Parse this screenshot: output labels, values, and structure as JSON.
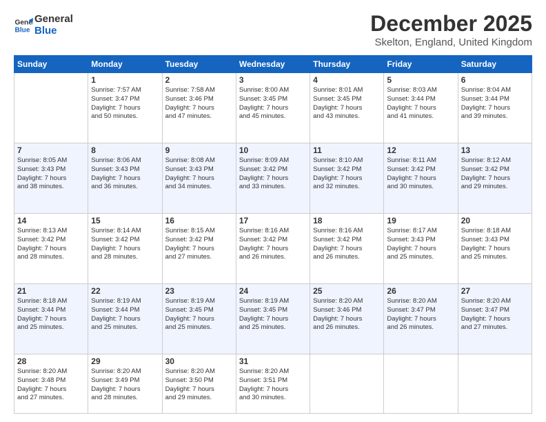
{
  "logo": {
    "line1": "General",
    "line2": "Blue"
  },
  "title": "December 2025",
  "subtitle": "Skelton, England, United Kingdom",
  "days_header": [
    "Sunday",
    "Monday",
    "Tuesday",
    "Wednesday",
    "Thursday",
    "Friday",
    "Saturday"
  ],
  "weeks": [
    [
      {
        "day": "",
        "info": ""
      },
      {
        "day": "1",
        "info": "Sunrise: 7:57 AM\nSunset: 3:47 PM\nDaylight: 7 hours\nand 50 minutes."
      },
      {
        "day": "2",
        "info": "Sunrise: 7:58 AM\nSunset: 3:46 PM\nDaylight: 7 hours\nand 47 minutes."
      },
      {
        "day": "3",
        "info": "Sunrise: 8:00 AM\nSunset: 3:45 PM\nDaylight: 7 hours\nand 45 minutes."
      },
      {
        "day": "4",
        "info": "Sunrise: 8:01 AM\nSunset: 3:45 PM\nDaylight: 7 hours\nand 43 minutes."
      },
      {
        "day": "5",
        "info": "Sunrise: 8:03 AM\nSunset: 3:44 PM\nDaylight: 7 hours\nand 41 minutes."
      },
      {
        "day": "6",
        "info": "Sunrise: 8:04 AM\nSunset: 3:44 PM\nDaylight: 7 hours\nand 39 minutes."
      }
    ],
    [
      {
        "day": "7",
        "info": "Sunrise: 8:05 AM\nSunset: 3:43 PM\nDaylight: 7 hours\nand 38 minutes."
      },
      {
        "day": "8",
        "info": "Sunrise: 8:06 AM\nSunset: 3:43 PM\nDaylight: 7 hours\nand 36 minutes."
      },
      {
        "day": "9",
        "info": "Sunrise: 8:08 AM\nSunset: 3:43 PM\nDaylight: 7 hours\nand 34 minutes."
      },
      {
        "day": "10",
        "info": "Sunrise: 8:09 AM\nSunset: 3:42 PM\nDaylight: 7 hours\nand 33 minutes."
      },
      {
        "day": "11",
        "info": "Sunrise: 8:10 AM\nSunset: 3:42 PM\nDaylight: 7 hours\nand 32 minutes."
      },
      {
        "day": "12",
        "info": "Sunrise: 8:11 AM\nSunset: 3:42 PM\nDaylight: 7 hours\nand 30 minutes."
      },
      {
        "day": "13",
        "info": "Sunrise: 8:12 AM\nSunset: 3:42 PM\nDaylight: 7 hours\nand 29 minutes."
      }
    ],
    [
      {
        "day": "14",
        "info": "Sunrise: 8:13 AM\nSunset: 3:42 PM\nDaylight: 7 hours\nand 28 minutes."
      },
      {
        "day": "15",
        "info": "Sunrise: 8:14 AM\nSunset: 3:42 PM\nDaylight: 7 hours\nand 28 minutes."
      },
      {
        "day": "16",
        "info": "Sunrise: 8:15 AM\nSunset: 3:42 PM\nDaylight: 7 hours\nand 27 minutes."
      },
      {
        "day": "17",
        "info": "Sunrise: 8:16 AM\nSunset: 3:42 PM\nDaylight: 7 hours\nand 26 minutes."
      },
      {
        "day": "18",
        "info": "Sunrise: 8:16 AM\nSunset: 3:42 PM\nDaylight: 7 hours\nand 26 minutes."
      },
      {
        "day": "19",
        "info": "Sunrise: 8:17 AM\nSunset: 3:43 PM\nDaylight: 7 hours\nand 25 minutes."
      },
      {
        "day": "20",
        "info": "Sunrise: 8:18 AM\nSunset: 3:43 PM\nDaylight: 7 hours\nand 25 minutes."
      }
    ],
    [
      {
        "day": "21",
        "info": "Sunrise: 8:18 AM\nSunset: 3:44 PM\nDaylight: 7 hours\nand 25 minutes."
      },
      {
        "day": "22",
        "info": "Sunrise: 8:19 AM\nSunset: 3:44 PM\nDaylight: 7 hours\nand 25 minutes."
      },
      {
        "day": "23",
        "info": "Sunrise: 8:19 AM\nSunset: 3:45 PM\nDaylight: 7 hours\nand 25 minutes."
      },
      {
        "day": "24",
        "info": "Sunrise: 8:19 AM\nSunset: 3:45 PM\nDaylight: 7 hours\nand 25 minutes."
      },
      {
        "day": "25",
        "info": "Sunrise: 8:20 AM\nSunset: 3:46 PM\nDaylight: 7 hours\nand 26 minutes."
      },
      {
        "day": "26",
        "info": "Sunrise: 8:20 AM\nSunset: 3:47 PM\nDaylight: 7 hours\nand 26 minutes."
      },
      {
        "day": "27",
        "info": "Sunrise: 8:20 AM\nSunset: 3:47 PM\nDaylight: 7 hours\nand 27 minutes."
      }
    ],
    [
      {
        "day": "28",
        "info": "Sunrise: 8:20 AM\nSunset: 3:48 PM\nDaylight: 7 hours\nand 27 minutes."
      },
      {
        "day": "29",
        "info": "Sunrise: 8:20 AM\nSunset: 3:49 PM\nDaylight: 7 hours\nand 28 minutes."
      },
      {
        "day": "30",
        "info": "Sunrise: 8:20 AM\nSunset: 3:50 PM\nDaylight: 7 hours\nand 29 minutes."
      },
      {
        "day": "31",
        "info": "Sunrise: 8:20 AM\nSunset: 3:51 PM\nDaylight: 7 hours\nand 30 minutes."
      },
      {
        "day": "",
        "info": ""
      },
      {
        "day": "",
        "info": ""
      },
      {
        "day": "",
        "info": ""
      }
    ]
  ]
}
